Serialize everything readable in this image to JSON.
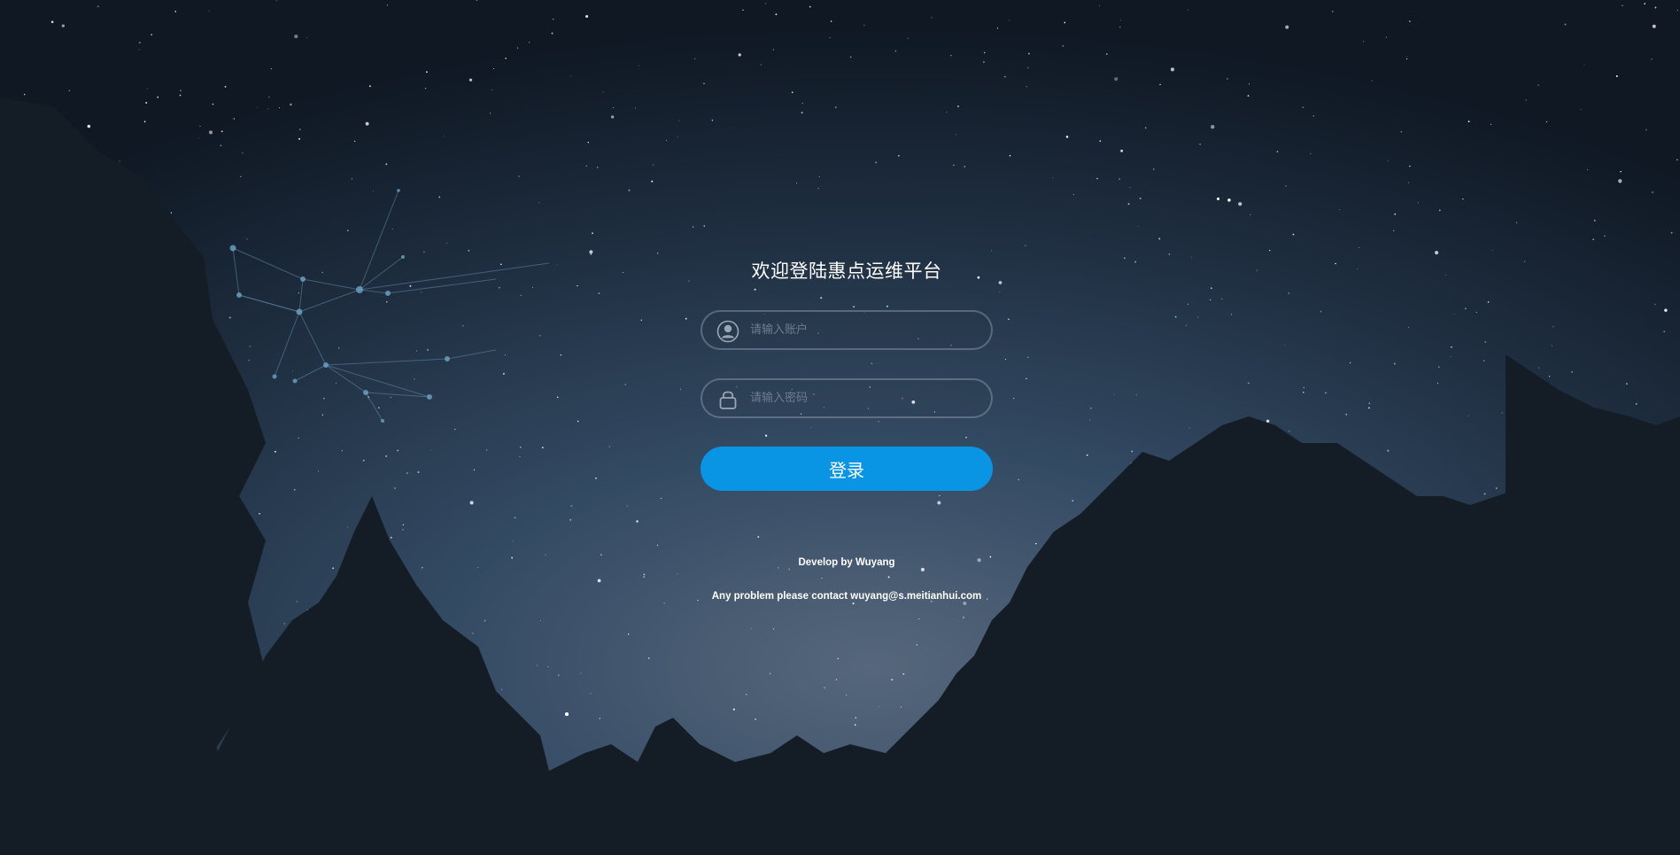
{
  "login": {
    "title": "欢迎登陆惠点运维平台",
    "account_placeholder": "请输入账户",
    "password_placeholder": "请输入密码",
    "account_value": "",
    "password_value": "",
    "submit_label": "登录"
  },
  "footer": {
    "developer": "Develop by Wuyang",
    "contact": "Any problem please contact wuyang@s.meitianhui.com"
  },
  "icons": {
    "account": "user-icon",
    "password": "lock-icon"
  },
  "colors": {
    "button": "#0a95e4",
    "field_border": "#96a5b9",
    "sky_top": "#0f1823",
    "sky_mid": "#334a63",
    "trees": "#141d26"
  }
}
